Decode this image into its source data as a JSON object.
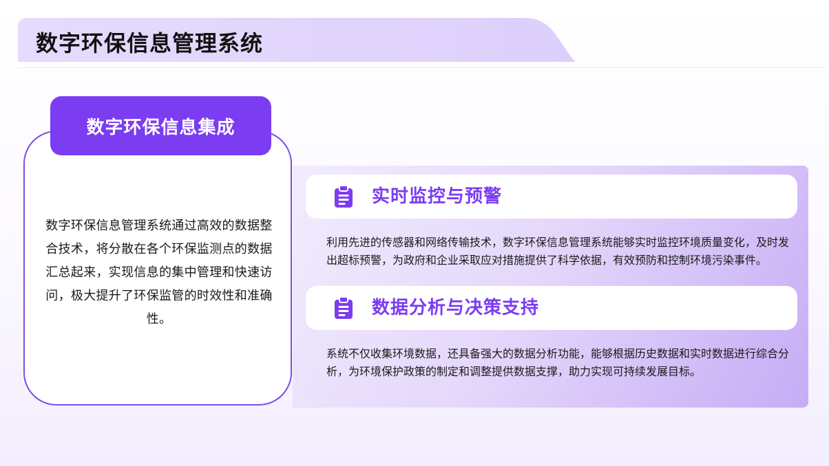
{
  "slide": {
    "title": "数字环保信息管理系统"
  },
  "left_card": {
    "tab_label": "数字环保信息集成",
    "body": "数字环保信息管理系统通过高效的数据整合技术，将分散在各个环保监测点的数据汇总起来，实现信息的集中管理和快速访问，极大提升了环保监管的时效性和准确性。"
  },
  "sections": [
    {
      "title": "实时监控与预警",
      "icon": "clipboard-icon",
      "body": "利用先进的传感器和网络传输技术，数字环保信息管理系统能够实时监控环境质量变化，及时发出超标预警，为政府和企业采取应对措施提供了科学依据，有效预防和控制环境污染事件。"
    },
    {
      "title": "数据分析与决策支持",
      "icon": "clipboard-icon",
      "body": "系统不仅收集环境数据，还具备强大的数据分析功能，能够根据历史数据和实时数据进行综合分析，为环境保护政策的制定和调整提供数据支撑，助力实现可持续发展目标。"
    }
  ],
  "colors": {
    "accent": "#7b3cf2",
    "banner": "#e2d5fd",
    "panel_light": "#f2ecfd",
    "panel_dark": "#c6acf5"
  }
}
